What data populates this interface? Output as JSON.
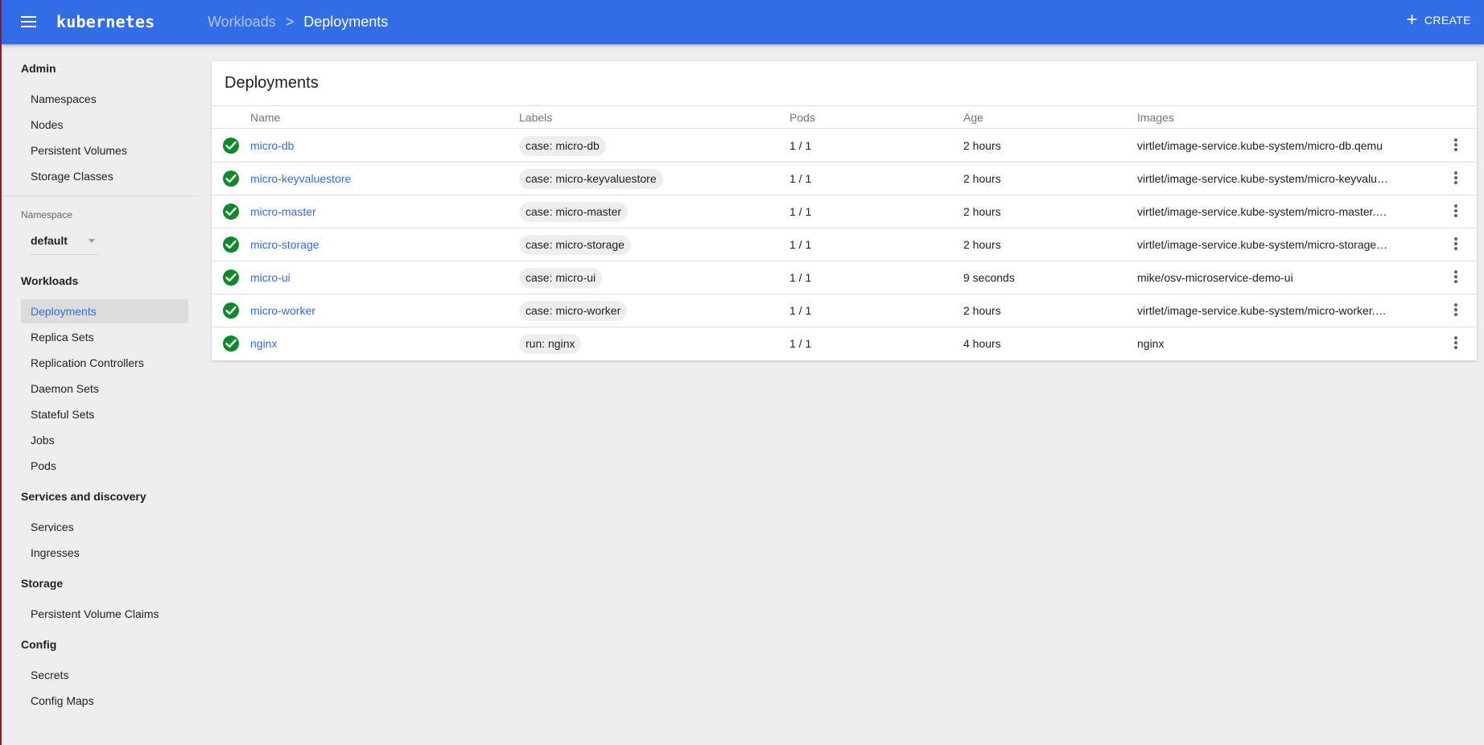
{
  "toolbar": {
    "brand": "kubernetes",
    "breadcrumb": {
      "parent": "Workloads",
      "separator": ">",
      "current": "Deployments"
    },
    "create_label": "CREATE",
    "color": "#326de6"
  },
  "sidebar": {
    "sections": {
      "admin": "Admin",
      "workloads": "Workloads",
      "services": "Services and discovery",
      "storage": "Storage",
      "config": "Config"
    },
    "admin_items": [
      "Namespaces",
      "Nodes",
      "Persistent Volumes",
      "Storage Classes"
    ],
    "namespace_label": "Namespace",
    "namespace_value": "default",
    "workload_items": [
      "Deployments",
      "Replica Sets",
      "Replication Controllers",
      "Daemon Sets",
      "Stateful Sets",
      "Jobs",
      "Pods"
    ],
    "active_item": "Deployments",
    "services_items": [
      "Services",
      "Ingresses"
    ],
    "storage_items": [
      "Persistent Volume Claims"
    ],
    "config_items": [
      "Secrets",
      "Config Maps"
    ]
  },
  "card": {
    "title": "Deployments",
    "columns": [
      "Name",
      "Labels",
      "Pods",
      "Age",
      "Images"
    ],
    "rows": [
      {
        "name": "micro-db",
        "label": "case: micro-db",
        "pods": "1 / 1",
        "age": "2 hours",
        "image": "virtlet/image-service.kube-system/micro-db.qemu"
      },
      {
        "name": "micro-keyvaluestore",
        "label": "case: micro-keyvaluestore",
        "pods": "1 / 1",
        "age": "2 hours",
        "image": "virtlet/image-service.kube-system/micro-keyvalu…"
      },
      {
        "name": "micro-master",
        "label": "case: micro-master",
        "pods": "1 / 1",
        "age": "2 hours",
        "image": "virtlet/image-service.kube-system/micro-master.…"
      },
      {
        "name": "micro-storage",
        "label": "case: micro-storage",
        "pods": "1 / 1",
        "age": "2 hours",
        "image": "virtlet/image-service.kube-system/micro-storage…"
      },
      {
        "name": "micro-ui",
        "label": "case: micro-ui",
        "pods": "1 / 1",
        "age": "9 seconds",
        "image": "mike/osv-microservice-demo-ui"
      },
      {
        "name": "micro-worker",
        "label": "case: micro-worker",
        "pods": "1 / 1",
        "age": "2 hours",
        "image": "virtlet/image-service.kube-system/micro-worker.…"
      },
      {
        "name": "nginx",
        "label": "run: nginx",
        "pods": "1 / 1",
        "age": "4 hours",
        "image": "nginx"
      }
    ]
  }
}
